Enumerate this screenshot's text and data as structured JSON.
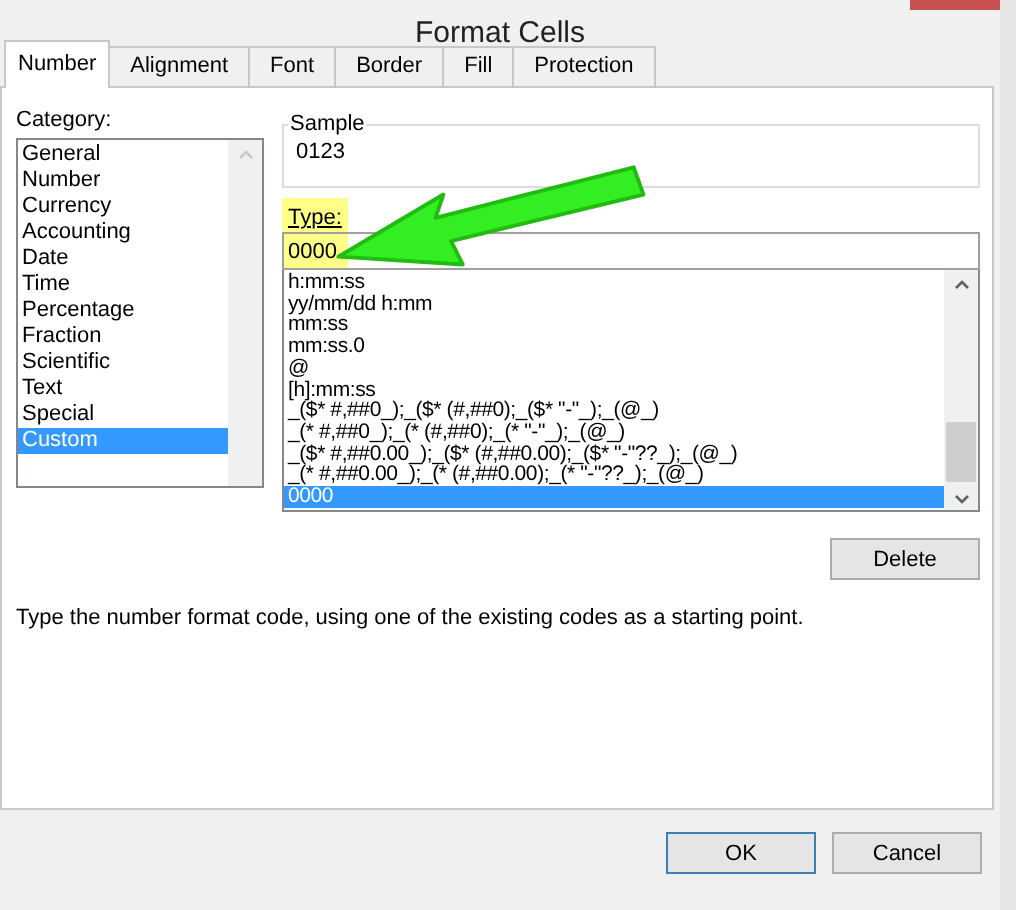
{
  "window": {
    "title": "Format Cells"
  },
  "tabs": [
    {
      "label": "Number",
      "selected": true
    },
    {
      "label": "Alignment",
      "selected": false
    },
    {
      "label": "Font",
      "selected": false
    },
    {
      "label": "Border",
      "selected": false
    },
    {
      "label": "Fill",
      "selected": false
    },
    {
      "label": "Protection",
      "selected": false
    }
  ],
  "category": {
    "label": "Category:",
    "items": [
      {
        "label": "General",
        "selected": false
      },
      {
        "label": "Number",
        "selected": false
      },
      {
        "label": "Currency",
        "selected": false
      },
      {
        "label": "Accounting",
        "selected": false
      },
      {
        "label": "Date",
        "selected": false
      },
      {
        "label": "Time",
        "selected": false
      },
      {
        "label": "Percentage",
        "selected": false
      },
      {
        "label": "Fraction",
        "selected": false
      },
      {
        "label": "Scientific",
        "selected": false
      },
      {
        "label": "Text",
        "selected": false
      },
      {
        "label": "Special",
        "selected": false
      },
      {
        "label": "Custom",
        "selected": true
      }
    ]
  },
  "sample": {
    "label": "Sample",
    "value": "0123"
  },
  "type": {
    "label": "Type:",
    "value": "0000"
  },
  "formats": [
    {
      "label": "h:mm:ss",
      "selected": false
    },
    {
      "label": "yy/mm/dd h:mm",
      "selected": false
    },
    {
      "label": "mm:ss",
      "selected": false
    },
    {
      "label": "mm:ss.0",
      "selected": false
    },
    {
      "label": "@",
      "selected": false
    },
    {
      "label": "[h]:mm:ss",
      "selected": false
    },
    {
      "label": "_($* #,##0_);_($* (#,##0);_($* \"-\"_);_(@_)",
      "selected": false
    },
    {
      "label": "_(* #,##0_);_(* (#,##0);_(* \"-\"_);_(@_)",
      "selected": false
    },
    {
      "label": "_($* #,##0.00_);_($* (#,##0.00);_($* \"-\"??_);_(@_)",
      "selected": false
    },
    {
      "label": "_(* #,##0.00_);_(* (#,##0.00);_(* \"-\"??_);_(@_)",
      "selected": false
    },
    {
      "label": "0000",
      "selected": true
    }
  ],
  "delete_button": "Delete",
  "description": "Type the number format code, using one of the existing codes as a starting point.",
  "buttons": [
    "OK",
    "Cancel"
  ]
}
